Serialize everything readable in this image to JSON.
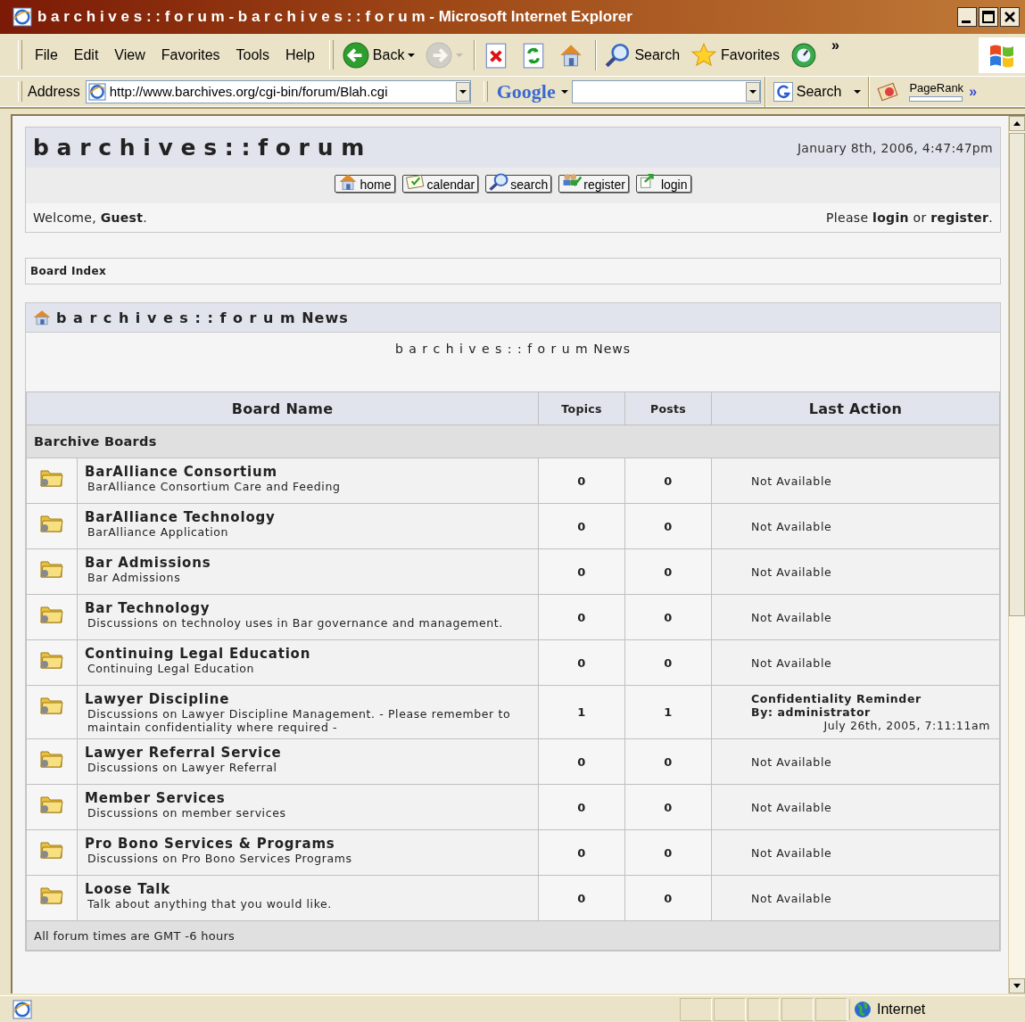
{
  "window": {
    "title": "b a r c h i v e s : : f o r u m - b a r c h i v e s : : f o r u m - Microsoft Internet Explorer"
  },
  "menu": [
    "File",
    "Edit",
    "View",
    "Favorites",
    "Tools",
    "Help"
  ],
  "toolbar": [
    {
      "kind": "back",
      "label": "Back",
      "dropdown": true,
      "disabled": false
    },
    {
      "kind": "forward",
      "dropdown": true,
      "disabled": true
    },
    {
      "kind": "stop",
      "dropdown": false,
      "disabled": false
    },
    {
      "kind": "refresh",
      "dropdown": false,
      "disabled": false
    },
    {
      "kind": "home",
      "dropdown": false,
      "disabled": false
    },
    {
      "kind": "search",
      "label": "Search",
      "dropdown": false,
      "disabled": false
    },
    {
      "kind": "favorites",
      "label": "Favorites",
      "dropdown": false,
      "disabled": false
    },
    {
      "kind": "media",
      "dropdown": false,
      "disabled": false
    }
  ],
  "chevron": "»",
  "address": {
    "label": "Address",
    "url": "http://www.barchives.org/cgi-bin/forum/Blah.cgi"
  },
  "google": {
    "logo": "Google",
    "search_label": "Search",
    "pagerank_label": "PageRank",
    "chevron": "»"
  },
  "forum": {
    "title": "b a r c h i v e s : : f o r u m",
    "datetime": "January 8th, 2006, 4:47:47pm",
    "nav": [
      {
        "kind": "home",
        "label": "home"
      },
      {
        "kind": "calendar",
        "label": "calendar"
      },
      {
        "kind": "search",
        "label": "search"
      },
      {
        "kind": "register",
        "label": "register"
      },
      {
        "kind": "login",
        "label": "login"
      }
    ],
    "welcome": "Welcome, **Guest**.",
    "login_prompt": "Please **login** or **register**.",
    "breadcrumb": "Board Index",
    "news_title": "b a r c h i v e s : : f o r u m News",
    "news_body": "b a r c h i v e s : : f o r u m News",
    "columns": [
      "Board Name",
      "Topics",
      "Posts",
      "Last Action"
    ],
    "category": "Barchive Boards",
    "boards": [
      {
        "name": "BarAlliance Consortium",
        "description": "BarAlliance Consortium Care and Feeding",
        "topics": "0",
        "posts": "0",
        "last": {
          "kind": "none",
          "text": "Not Available"
        }
      },
      {
        "name": "BarAlliance Technology",
        "description": "BarAlliance Application",
        "topics": "0",
        "posts": "0",
        "last": {
          "kind": "none",
          "text": "Not Available"
        }
      },
      {
        "name": "Bar Admissions",
        "description": "Bar Admissions",
        "topics": "0",
        "posts": "0",
        "last": {
          "kind": "none",
          "text": "Not Available"
        }
      },
      {
        "name": "Bar Technology",
        "description": "Discussions on technoloy uses in Bar governance and management.",
        "topics": "0",
        "posts": "0",
        "last": {
          "kind": "none",
          "text": "Not Available"
        }
      },
      {
        "name": "Continuing Legal Education",
        "description": "Continuing Legal Education",
        "topics": "0",
        "posts": "0",
        "last": {
          "kind": "none",
          "text": "Not Available"
        }
      },
      {
        "name": "Lawyer Discipline",
        "description": "Discussions on Lawyer Discipline Management. - Please remember to maintain confidentiality where required -",
        "topics": "1",
        "posts": "1",
        "last": {
          "kind": "post",
          "title": "Confidentiality Reminder",
          "by": "By: administrator",
          "date": "July 26th, 2005, 7:11:11am"
        }
      },
      {
        "name": "Lawyer Referral Service",
        "description": "Discussions on Lawyer Referral",
        "topics": "0",
        "posts": "0",
        "last": {
          "kind": "none",
          "text": "Not Available"
        }
      },
      {
        "name": "Member Services",
        "description": "Discussions on member services",
        "topics": "0",
        "posts": "0",
        "last": {
          "kind": "none",
          "text": "Not Available"
        }
      },
      {
        "name": "Pro Bono Services & Programs",
        "description": "Discussions on Pro Bono Services Programs",
        "topics": "0",
        "posts": "0",
        "last": {
          "kind": "none",
          "text": "Not Available"
        }
      },
      {
        "name": "Loose Talk",
        "description": "Talk about anything that you would like.",
        "topics": "0",
        "posts": "0",
        "last": {
          "kind": "none",
          "text": "Not Available"
        }
      }
    ],
    "footer": "All forum times are GMT -6 hours"
  },
  "status": {
    "zone": "Internet"
  }
}
